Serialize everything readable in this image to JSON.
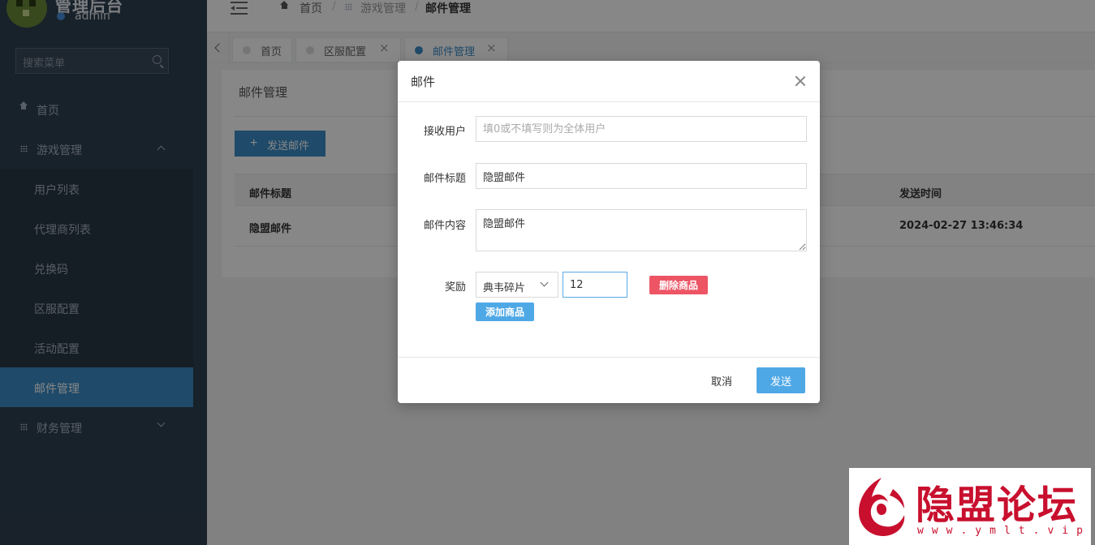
{
  "sidebar": {
    "app_title": "管理后台",
    "user": "admin",
    "search_placeholder": "搜索菜单",
    "items": {
      "home": "首页",
      "game_mgmt": "游戏管理",
      "user_list": "用户列表",
      "agent_list": "代理商列表",
      "redeem_code": "兑换码",
      "server_config": "区服配置",
      "activity_config": "活动配置",
      "mail_mgmt": "邮件管理",
      "finance_mgmt": "财务管理"
    }
  },
  "breadcrumb": {
    "home": "首页",
    "sep": "/",
    "level1": "游戏管理",
    "current": "邮件管理"
  },
  "tabs": {
    "home": "首页",
    "server_config": "区服配置",
    "mail_mgmt": "邮件管理",
    "close_glyph": "×"
  },
  "page": {
    "title": "邮件管理",
    "send_button": "发送邮件",
    "plus_glyph": "+",
    "table": {
      "columns": {
        "mail_title": "邮件标题",
        "send_time": "发送时间"
      },
      "rows": [
        {
          "mail_title": "隐盟邮件",
          "send_time": "2024-02-27 13:46:34"
        }
      ]
    }
  },
  "modal": {
    "title": "邮件",
    "recipient_label": "接收用户",
    "recipient_placeholder": "填0或不填写则为全体用户",
    "recipient_value": "",
    "subject_label": "邮件标题",
    "subject_value": "隐盟邮件",
    "content_label": "邮件内容",
    "content_value": "隐盟邮件",
    "reward_label": "奖励",
    "reward_item": "典韦碎片",
    "reward_qty": "12",
    "delete_item_button": "删除商品",
    "add_item_button": "添加商品",
    "cancel_button": "取消",
    "send_button": "发送"
  },
  "watermark": {
    "text": "隐盟论坛",
    "url": "www.ymlt.vip"
  },
  "colors": {
    "sidebar_bg": "#2f4050",
    "active_blue": "#3c8dc6",
    "primary_button": "#4fa8e6",
    "danger_button": "#ed5565",
    "watermark_red": "#c8102e"
  }
}
